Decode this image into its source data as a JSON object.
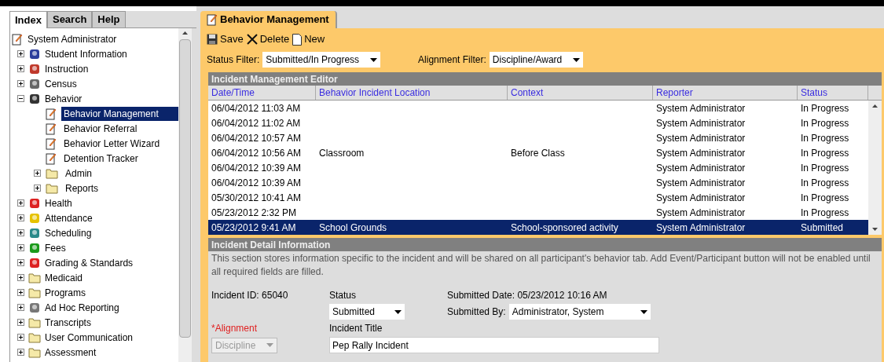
{
  "left_tabs": [
    {
      "label": "Index",
      "selected": true
    },
    {
      "label": "Search",
      "selected": false
    },
    {
      "label": "Help",
      "selected": false
    }
  ],
  "tree_root": "System Administrator",
  "tree": [
    {
      "label": "Student Information",
      "expanded": false
    },
    {
      "label": "Instruction",
      "expanded": false
    },
    {
      "label": "Census",
      "expanded": false
    },
    {
      "label": "Behavior",
      "expanded": true,
      "children": [
        {
          "label": "Behavior Management",
          "selected": true
        },
        {
          "label": "Behavior Referral",
          "selected": false
        },
        {
          "label": "Behavior Letter Wizard",
          "selected": false
        },
        {
          "label": "Detention Tracker",
          "selected": false
        },
        {
          "label": "Admin",
          "expanded": false
        },
        {
          "label": "Reports",
          "expanded": false
        }
      ]
    },
    {
      "label": "Health",
      "expanded": false
    },
    {
      "label": "Attendance",
      "expanded": false
    },
    {
      "label": "Scheduling",
      "expanded": false
    },
    {
      "label": "Fees",
      "expanded": false
    },
    {
      "label": "Grading & Standards",
      "expanded": false
    },
    {
      "label": "Medicaid",
      "expanded": false
    },
    {
      "label": "Programs",
      "expanded": false
    },
    {
      "label": "Ad Hoc Reporting",
      "expanded": false
    },
    {
      "label": "Transcripts",
      "expanded": false
    },
    {
      "label": "User Communication",
      "expanded": false
    },
    {
      "label": "Assessment",
      "expanded": false
    }
  ],
  "page_tab": "Behavior Management",
  "toolbar": [
    "Save",
    "Delete",
    "New"
  ],
  "filters": [
    {
      "label": "Status Filter:",
      "value": "Submitted/In Progress"
    },
    {
      "label": "Alignment Filter:",
      "value": "Discipline/Award"
    }
  ],
  "editor_title": "Incident Management Editor",
  "table": {
    "columns": [
      "Date/Time",
      "Behavior Incident Location",
      "Context",
      "Reporter",
      "Status"
    ],
    "rows": [
      {
        "cells": [
          "06/04/2012 11:03 AM",
          "",
          "",
          "System Administrator",
          "In Progress"
        ],
        "selected": false
      },
      {
        "cells": [
          "06/04/2012 11:02 AM",
          "",
          "",
          "System Administrator",
          "In Progress"
        ],
        "selected": false
      },
      {
        "cells": [
          "06/04/2012 10:57 AM",
          "",
          "",
          "System Administrator",
          "In Progress"
        ],
        "selected": false
      },
      {
        "cells": [
          "06/04/2012 10:56 AM",
          "Classroom",
          "Before Class",
          "System Administrator",
          "In Progress"
        ],
        "selected": false
      },
      {
        "cells": [
          "06/04/2012 10:39 AM",
          "",
          "",
          "System Administrator",
          "In Progress"
        ],
        "selected": false
      },
      {
        "cells": [
          "06/04/2012 10:39 AM",
          "",
          "",
          "System Administrator",
          "In Progress"
        ],
        "selected": false
      },
      {
        "cells": [
          "05/30/2012 10:41 AM",
          "",
          "",
          "System Administrator",
          "In Progress"
        ],
        "selected": false
      },
      {
        "cells": [
          "05/23/2012 2:32 PM",
          "",
          "",
          "System Administrator",
          "In Progress"
        ],
        "selected": false
      },
      {
        "cells": [
          "05/23/2012 9:41 AM",
          "School Grounds",
          "School-sponsored activity",
          "System Administrator",
          "Submitted"
        ],
        "selected": true
      }
    ]
  },
  "detail": {
    "title": "Incident Detail Information",
    "description": "This section stores information specific to the incident and will be shared on all participant's behavior tab. Add Event/Participant button will not be enabled until all required fields are filled.",
    "incident_id": "Incident ID: 65040",
    "status_label": "Status",
    "status_value": "Submitted",
    "submitted_date": "Submitted Date: 05/23/2012 10:16 AM",
    "submitted_by_label": "Submitted By:",
    "submitted_by_value": "Administrator, System",
    "alignment_label": "*Alignment",
    "alignment_value": "Discipline",
    "alignment_disabled": true,
    "title_label": "Incident Title",
    "title_value": "Pep Rally Incident"
  }
}
